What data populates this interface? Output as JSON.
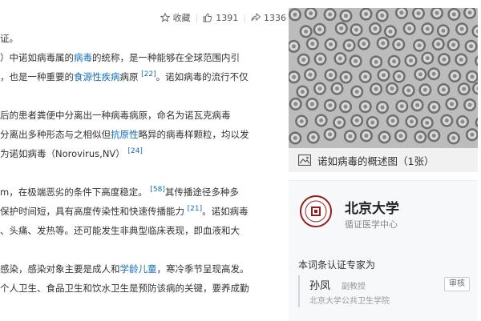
{
  "toolbar": {
    "collect_label": "收藏",
    "like_count": "1391",
    "share_count": "1336"
  },
  "article": {
    "lines": [
      [
        "证。"
      ],
      [
        "）中诺如病毒属的",
        {
          "link": "病毒"
        },
        "的统称，是一种能够在全球范围内引"
      ],
      [
        "，也是一种重要的",
        {
          "link": "食源性疾病"
        },
        "病原 ",
        {
          "sup": "[22]"
        },
        "。诺如病毒的流行不仅"
      ],
      [],
      [
        "后的患者粪便中分离出一种病毒病原，命名为诺瓦克病毒"
      ],
      [
        "分离出多种形态与之相似但",
        {
          "link": "抗原性"
        },
        "略异的病毒样颗粒，均以发"
      ],
      [
        "为诺如病毒（Norovirus,NV） ",
        {
          "sup": "[24]"
        }
      ],
      [],
      [
        "m，在极端恶劣的条件下高度稳定。 ",
        {
          "sup": "[58]"
        },
        "其传播途径多种多"
      ],
      [
        "保护时间短，具有高度传染性和快速传播能力 ",
        {
          "sup": "[21]"
        },
        "。诺如病毒"
      ],
      [
        "、头痛、发热等。还可能发生非典型临床表现，即血液和大"
      ],
      [],
      [
        "感染，感染对象主要是成人和",
        {
          "link": "学龄儿童"
        },
        "，寒冷季节呈现高发。"
      ],
      [
        "个人卫生、食品卫生和饮水卫生是预防该病的关键，要养成勤"
      ]
    ]
  },
  "image_card": {
    "caption": "诺如病毒的概述图（1张）"
  },
  "cert_card": {
    "university": "北京大学",
    "center": "循证医学中心",
    "certified_by": "本词条认证专家为",
    "expert_name": "孙凤",
    "expert_title": "副教授",
    "expert_org": "北京大学公共卫生学院",
    "review_label": "审核"
  },
  "colors": {
    "link": "#136ec2",
    "text": "#333333",
    "muted": "#999999"
  }
}
